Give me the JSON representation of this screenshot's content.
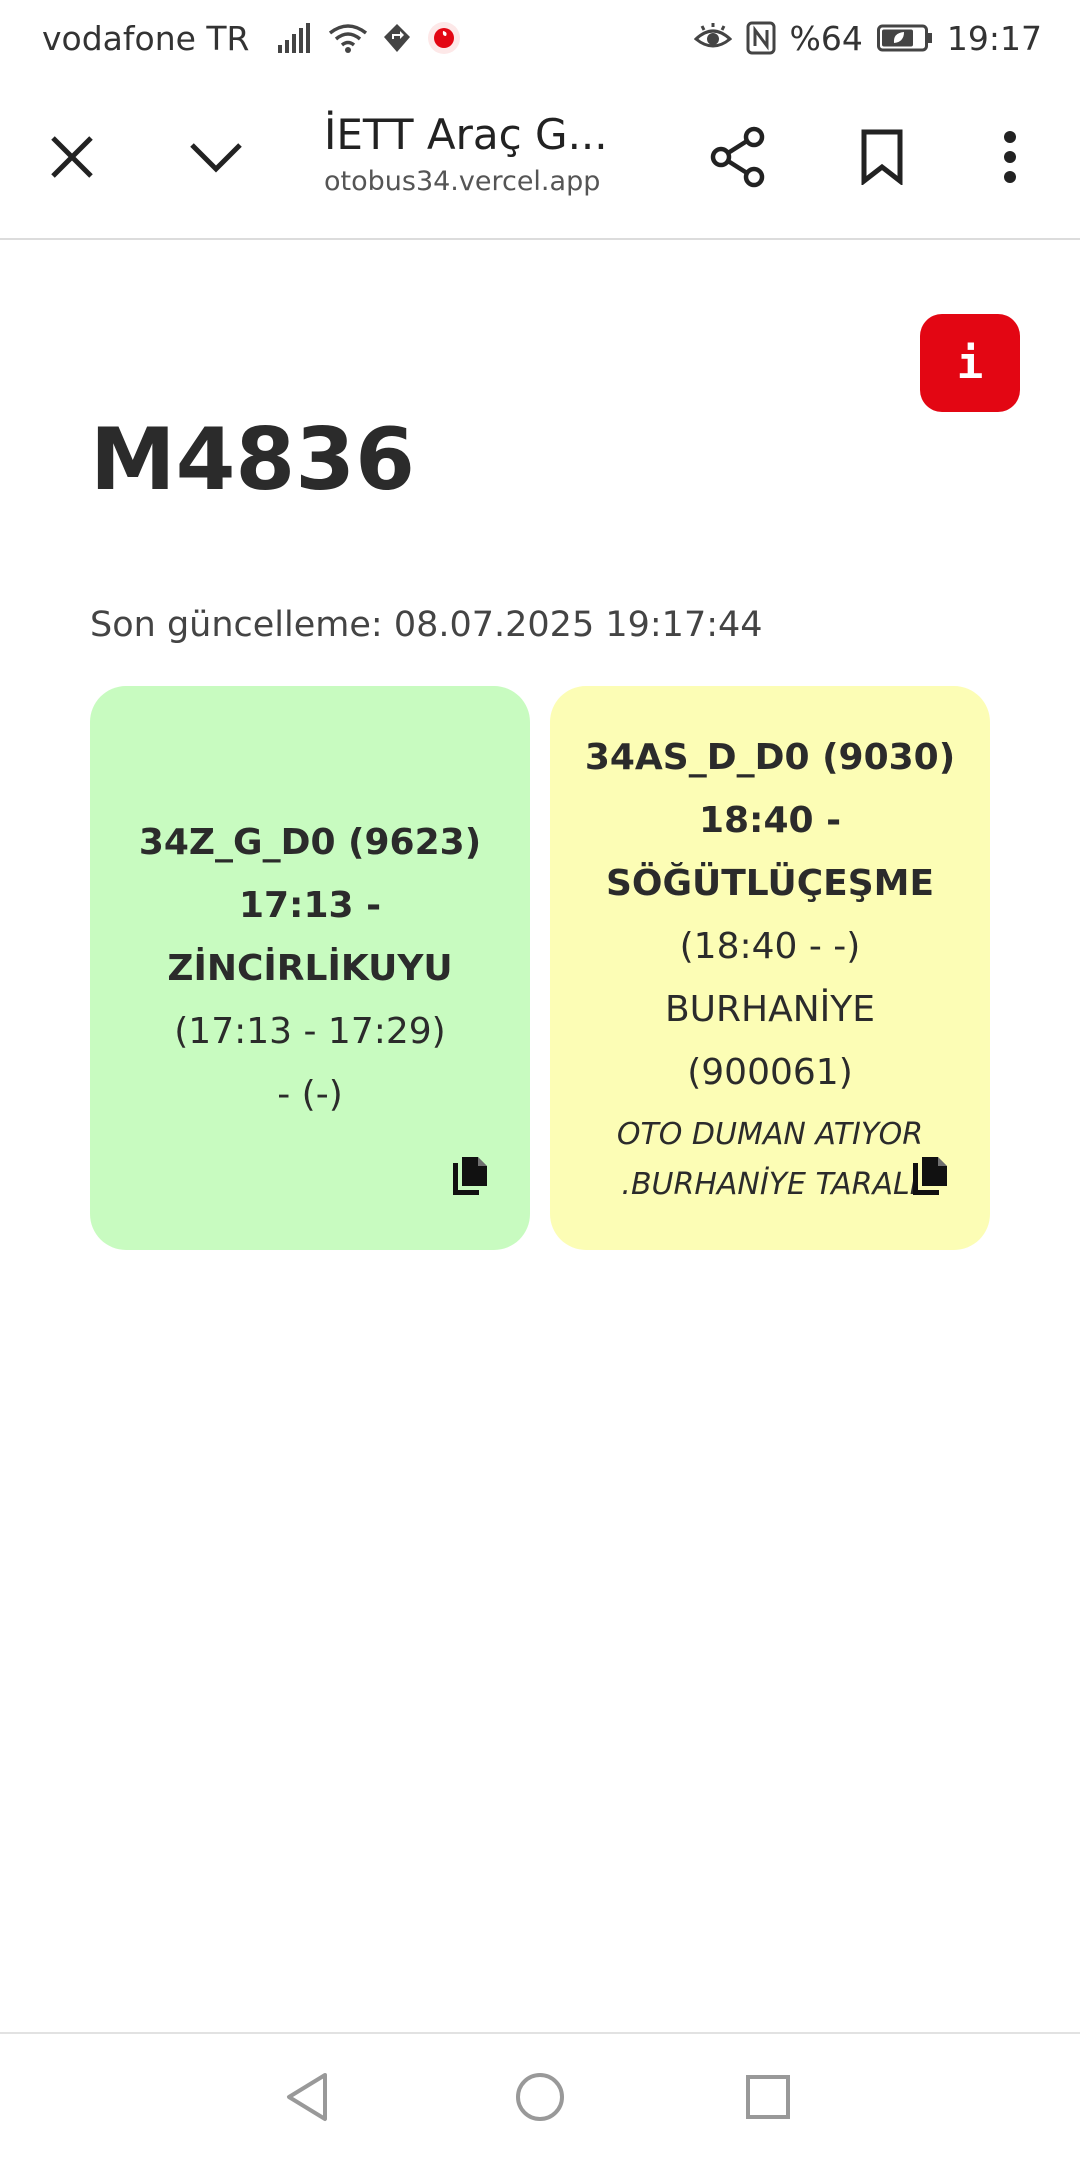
{
  "status_bar": {
    "carrier": "vodafone TR",
    "battery": "%64",
    "time": "19:17"
  },
  "toolbar": {
    "title": "İETT Araç G...",
    "url": "otobus34.vercel.app"
  },
  "page": {
    "info_label": "i",
    "vehicle_id": "M4836",
    "last_update": "Son güncelleme: 08.07.2025 19:17:44",
    "cards": [
      {
        "color": "#c8fbc0",
        "route": "34Z_G_D0 (9623)",
        "time_line": "17:13 -",
        "destination": "ZİNCİRLİKUYU",
        "time_range": "(17:13 - 17:29)",
        "extra": "- (-)"
      },
      {
        "color": "#fcfdb5",
        "route": "34AS_D_D0 (9030)",
        "time_line": "18:40 -",
        "destination": "SÖĞÜTLÜÇEŞME",
        "time_range": "(18:40 - -)",
        "stop_name": "BURHANİYE",
        "stop_code": "(900061)",
        "note_line1": "OTO DUMAN ATIYOR",
        "note_line2": ".BURHANİYE TARALI"
      }
    ]
  },
  "colors": {
    "accent_red": "#e30613",
    "card_green": "#c8fbc0",
    "card_yellow": "#fcfdb5"
  }
}
